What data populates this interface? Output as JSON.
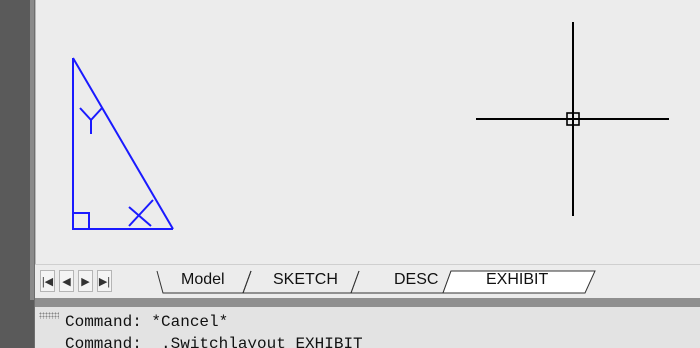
{
  "layout_tabs": {
    "model": "Model",
    "sketch": "SKETCH",
    "desc": "DESC",
    "exhibit": "EXHIBIT",
    "active": "EXHIBIT"
  },
  "nav_buttons": [
    "first-layout",
    "previous-layout",
    "next-layout",
    "last-layout"
  ],
  "drawing": {
    "entity": "right triangle",
    "angle_labels": [
      "Y",
      "X"
    ],
    "line_color": "#1a1aff",
    "crosshair_color": "#000000"
  },
  "command_line": {
    "history": [
      "Command: *Cancel*",
      "Command: _.Switchlayout EXHIBIT"
    ]
  },
  "colors": {
    "canvas_bg": "#ececec",
    "tab_bar_bg": "#ececec",
    "command_bg": "#e3e3e3"
  }
}
